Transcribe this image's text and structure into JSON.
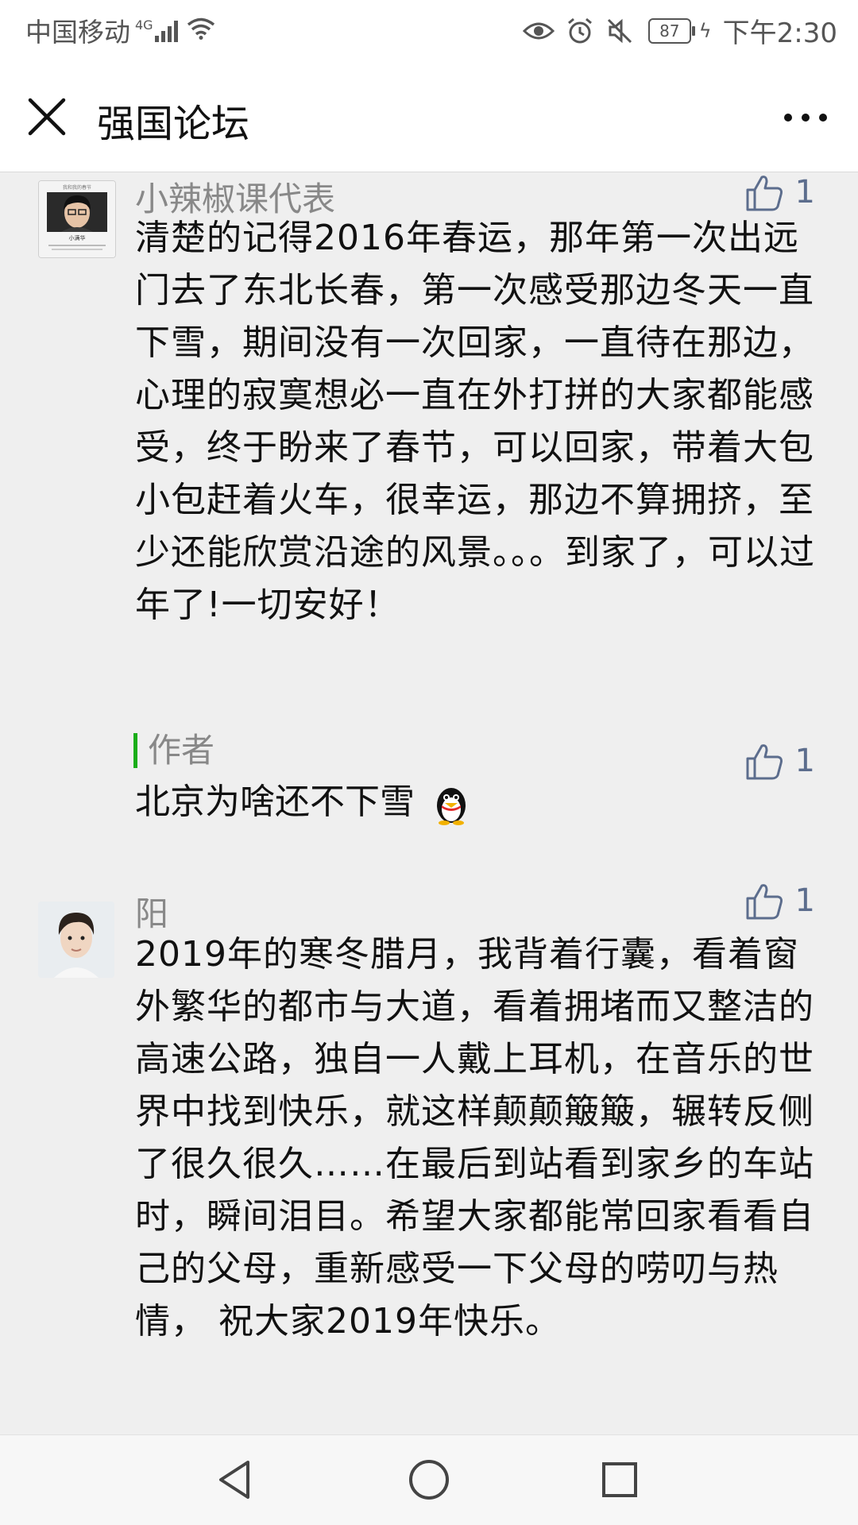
{
  "status_bar": {
    "carrier": "中国移动",
    "network": "4G",
    "battery": "87",
    "time": "下午2:30",
    "icons": [
      "signal-icon",
      "wifi-icon",
      "eye-icon",
      "alarm-icon",
      "mute-icon",
      "battery-icon",
      "charging-icon"
    ]
  },
  "header": {
    "title": "强国论坛",
    "close_icon": "close-icon",
    "more_icon": "more-icon"
  },
  "comments": [
    {
      "username": "小辣椒课代表",
      "likes": "1",
      "text": "清楚的记得2016年春运，那年第一次出远门去了东北长春，第一次感受那边冬天一直下雪，期间没有一次回家，一直待在那边，心理的寂寞想必一直在外打拼的大家都能感受，终于盼来了春节，可以回家，带着大包小包赶着火车，很幸运，那边不算拥挤，至少还能欣赏沿途的风景。。。到家了，可以过年了!一切安好！",
      "author_reply": {
        "label": "作者",
        "likes": "1",
        "text": "北京为啥还不下雪"
      }
    },
    {
      "username": "阳",
      "likes": "1",
      "text": "2019年的寒冬腊月，我背着行囊，看着窗外繁华的都市与大道，看着拥堵而又整洁的高速公路，独自一人戴上耳机，在音乐的世界中找到快乐，就这样颠颠簸簸，辗转反侧了很久很久……在最后到站看到家乡的车站时，瞬间泪目。希望大家都能常回家看看自己的父母，重新感受一下父母的唠叨与热情， 祝大家2019年快乐。"
    }
  ],
  "avatar_caption": "小辣椒课代表",
  "avatar_subcaption": "小满华",
  "nav": {
    "back_icon": "back-triangle-icon",
    "home_icon": "home-circle-icon",
    "recents_icon": "recents-square-icon"
  },
  "colors": {
    "like": "#5c6d8d",
    "author_bar": "#1aad19",
    "background": "#efefef"
  }
}
